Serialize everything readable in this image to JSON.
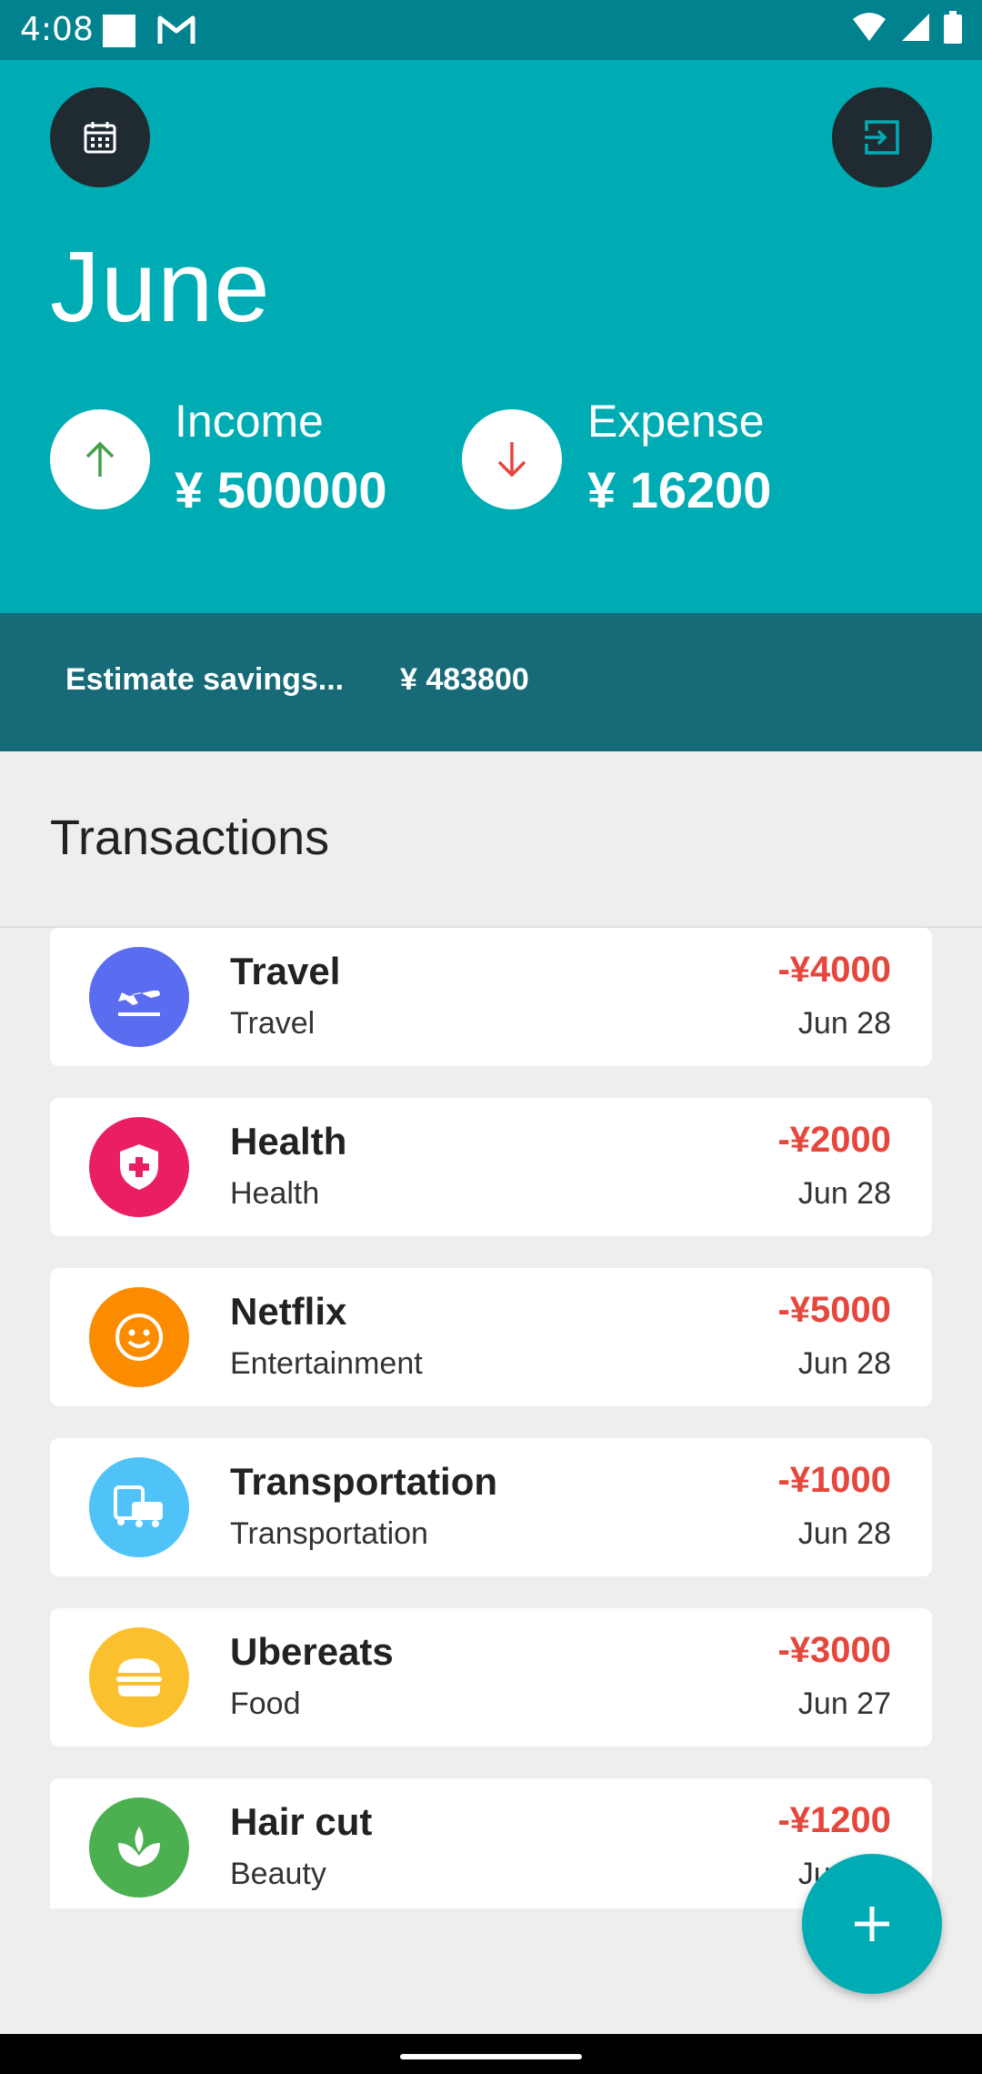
{
  "status_bar": {
    "time": "4:08"
  },
  "header": {
    "month": "June",
    "income": {
      "label": "Income",
      "value": "¥ 500000"
    },
    "expense": {
      "label": "Expense",
      "value": "¥ 16200"
    }
  },
  "savings": {
    "label": "Estimate savings...",
    "value": "¥ 483800"
  },
  "transactions": {
    "title": "Transactions",
    "items": [
      {
        "name": "Travel",
        "category": "Travel",
        "amount": "-¥4000",
        "date": "Jun 28",
        "icon": "airplane-icon",
        "color": "#5a6cf0"
      },
      {
        "name": "Health",
        "category": "Health",
        "amount": "-¥2000",
        "date": "Jun 28",
        "icon": "shield-cross-icon",
        "color": "#e91e63"
      },
      {
        "name": "Netflix",
        "category": "Entertainment",
        "amount": "-¥5000",
        "date": "Jun 28",
        "icon": "smiley-icon",
        "color": "#fb8c00"
      },
      {
        "name": "Transportation",
        "category": "Transportation",
        "amount": "-¥1000",
        "date": "Jun 28",
        "icon": "bus-car-icon",
        "color": "#4fc3f7"
      },
      {
        "name": "Ubereats",
        "category": "Food",
        "amount": "-¥3000",
        "date": "Jun 27",
        "icon": "burger-icon",
        "color": "#fbc02d"
      },
      {
        "name": "Hair cut",
        "category": "Beauty",
        "amount": "-¥1200",
        "date": "Jun 27",
        "icon": "leaf-icon",
        "color": "#4caf50"
      }
    ]
  },
  "colors": {
    "primary": "#00acb3",
    "savings_bar": "#176a78",
    "expense_red": "#e5473c",
    "income_green": "#43a047"
  }
}
